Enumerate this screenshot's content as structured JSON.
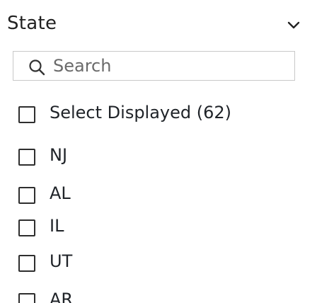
{
  "filter": {
    "title": "State",
    "search": {
      "placeholder": "Search",
      "value": ""
    },
    "select_all_label": "Select Displayed (62)",
    "options": [
      {
        "label": "NJ",
        "checked": false
      },
      {
        "label": "AL",
        "checked": false
      },
      {
        "label": "IL",
        "checked": false
      },
      {
        "label": "UT",
        "checked": false
      },
      {
        "label": "AR",
        "checked": false
      }
    ]
  }
}
